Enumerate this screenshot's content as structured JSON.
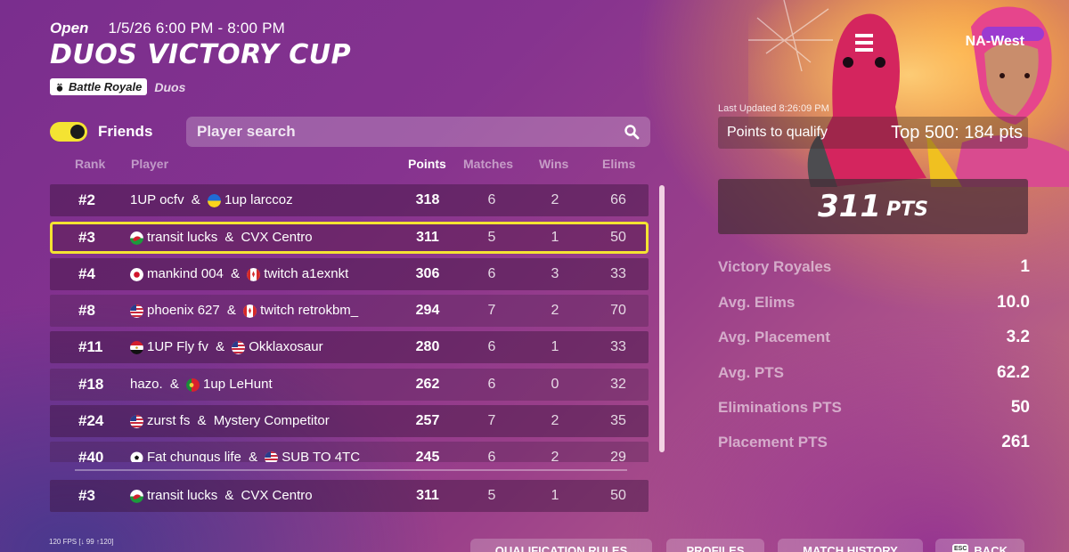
{
  "header": {
    "status": "Open",
    "datetime": "1/5/26 6:00 PM - 8:00 PM",
    "title": "DUOS VICTORY CUP",
    "mode": "Battle Royale",
    "submode": "Duos",
    "region": "NA-West"
  },
  "controls": {
    "friends_label": "Friends",
    "friends_toggle_on": true,
    "search_placeholder": "Player search"
  },
  "table": {
    "columns": {
      "rank": "Rank",
      "player": "Player",
      "points": "Points",
      "matches": "Matches",
      "wins": "Wins",
      "elims": "Elims"
    },
    "rows": [
      {
        "rank": "#2",
        "p1": "1UP ocfv",
        "f1": "",
        "sep": " & ",
        "f2": "ukraine",
        "p2": "1up larccoz",
        "points": "318",
        "matches": "6",
        "wins": "2",
        "elims": "66"
      },
      {
        "rank": "#3",
        "p1": "transit lucks",
        "f1": "wales",
        "sep": " & ",
        "f2": "",
        "p2": "CVX Centro",
        "points": "311",
        "matches": "5",
        "wins": "1",
        "elims": "50"
      },
      {
        "rank": "#4",
        "p1": "mankind 004",
        "f1": "japan",
        "sep": " & ",
        "f2": "canada",
        "p2": "twitch a1exnkt",
        "points": "306",
        "matches": "6",
        "wins": "3",
        "elims": "33"
      },
      {
        "rank": "#8",
        "p1": "phoenix 627",
        "f1": "usa",
        "sep": " & ",
        "f2": "canada",
        "p2": "twitch retrokbm_",
        "points": "294",
        "matches": "7",
        "wins": "2",
        "elims": "70"
      },
      {
        "rank": "#11",
        "p1": "1UP Fly fv",
        "f1": "egypt",
        "sep": " & ",
        "f2": "usa",
        "p2": "Okklaxosaur",
        "points": "280",
        "matches": "6",
        "wins": "1",
        "elims": "33"
      },
      {
        "rank": "#18",
        "p1": "hazo.",
        "f1": "",
        "sep": " & ",
        "f2": "portugal",
        "p2": "1up LeHunt",
        "points": "262",
        "matches": "6",
        "wins": "0",
        "elims": "32"
      },
      {
        "rank": "#24",
        "p1": "zurst fs",
        "f1": "usa",
        "sep": " & ",
        "f2": "",
        "p2": "Mystery Competitor",
        "points": "257",
        "matches": "7",
        "wins": "2",
        "elims": "35"
      },
      {
        "rank": "#40",
        "p1": "Fat chungus life",
        "f1": "soccer",
        "sep": " & ",
        "f2": "usa",
        "p2": "SUB TO 4TC",
        "points": "245",
        "matches": "6",
        "wins": "2",
        "elims": "29"
      }
    ],
    "pinned": {
      "rank": "#3",
      "p1": "transit lucks",
      "f1": "wales",
      "sep": " & ",
      "f2": "",
      "p2": "CVX Centro",
      "points": "311",
      "matches": "5",
      "wins": "1",
      "elims": "50"
    }
  },
  "summary": {
    "last_updated": "Last Updated 8:26:09 PM",
    "qualify_label": "Points to qualify",
    "qualify_value": "Top 500: 184 pts",
    "total_points": "311",
    "total_unit": "PTS",
    "stats": [
      {
        "label": "Victory Royales",
        "value": "1"
      },
      {
        "label": "Avg. Elims",
        "value": "10.0"
      },
      {
        "label": "Avg. Placement",
        "value": "3.2"
      },
      {
        "label": "Avg. PTS",
        "value": "62.2"
      },
      {
        "label": "Eliminations PTS",
        "value": "50"
      },
      {
        "label": "Placement PTS",
        "value": "261"
      }
    ]
  },
  "footer": {
    "fps": "120 FPS [↓ 99 ↑120]",
    "buttons": [
      "QUALIFICATION RULES",
      "PROFILES",
      "MATCH HISTORY",
      "BACK"
    ],
    "esc_key": "ESC"
  },
  "colors": {
    "accent_yellow": "#f4e332",
    "toggle_knob": "#1b1b1b"
  },
  "icons": {
    "battle_royale": "crown-drop-icon",
    "search": "magnifier-icon"
  }
}
